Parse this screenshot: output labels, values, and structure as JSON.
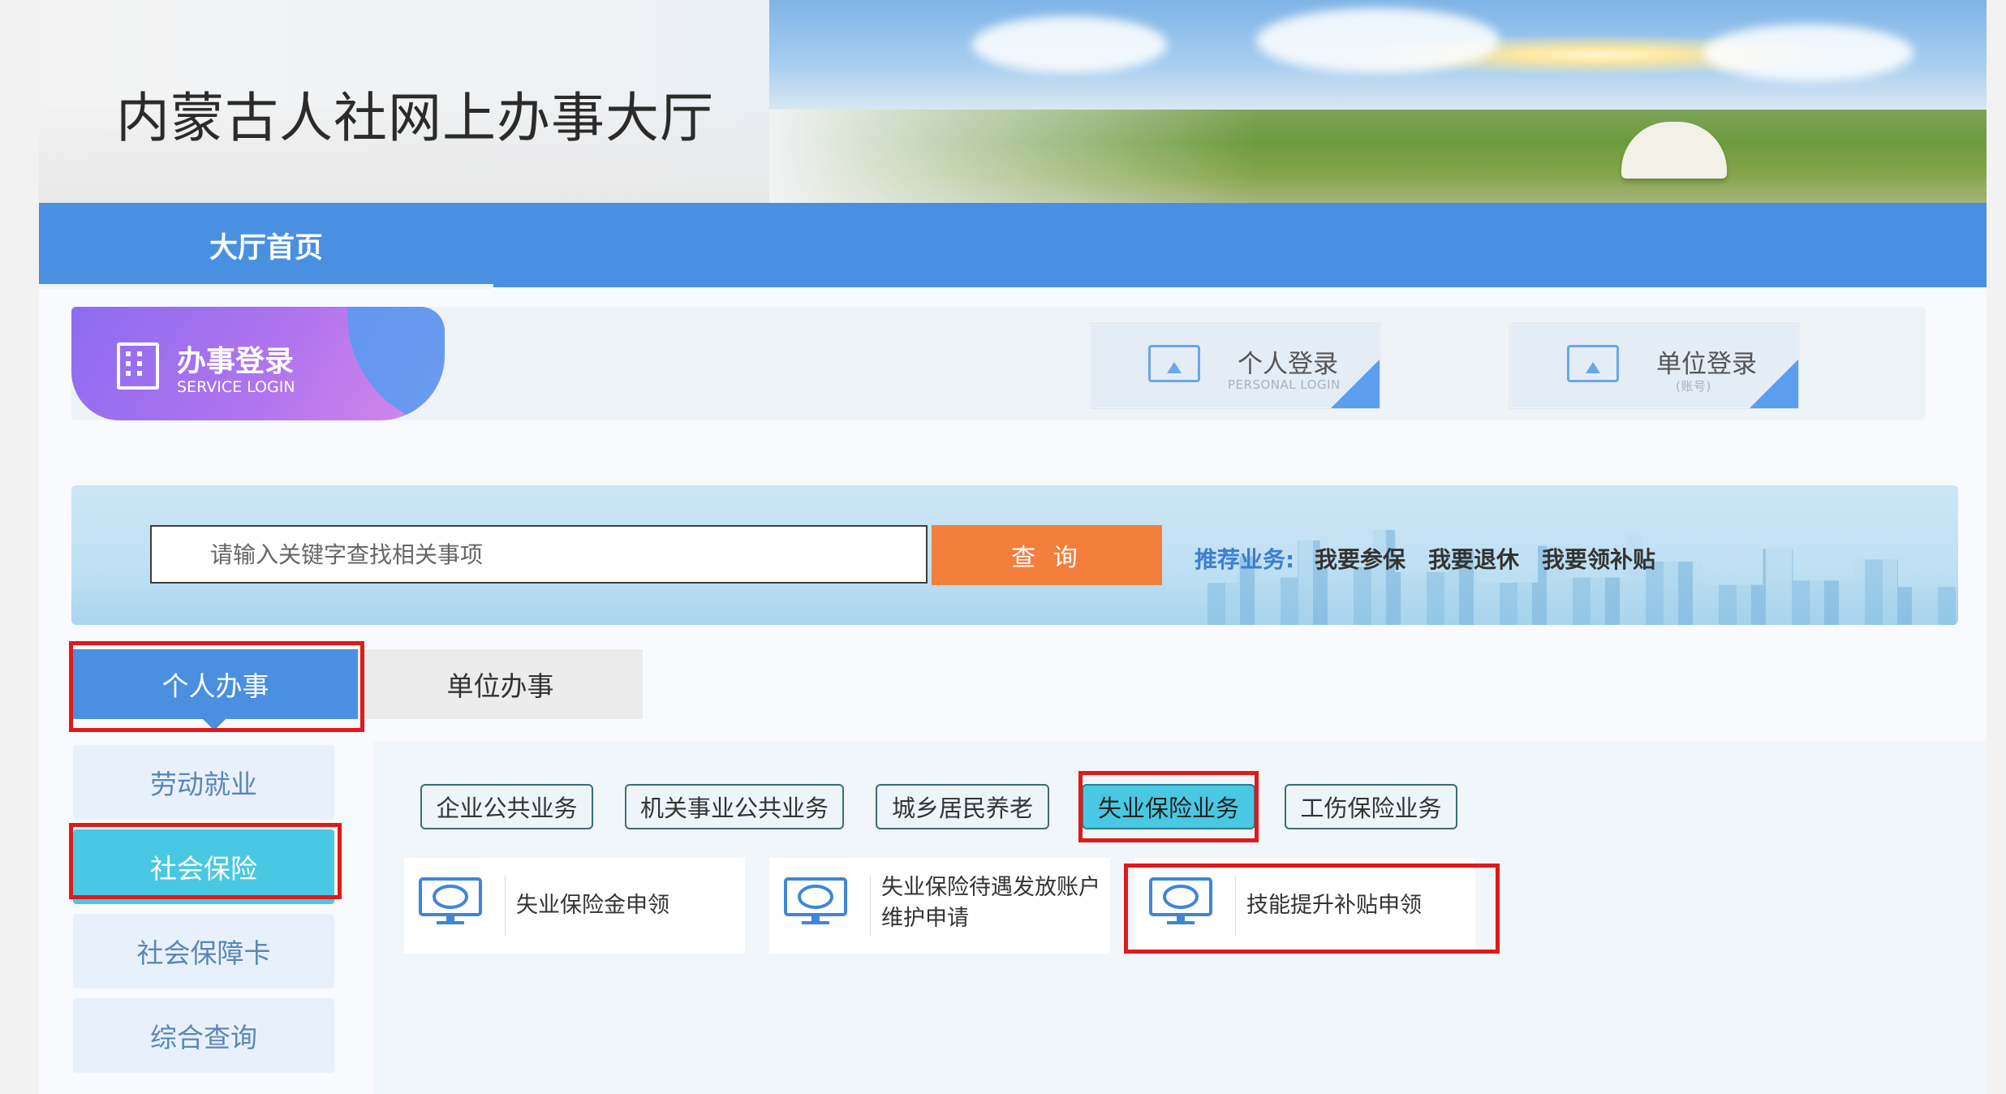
{
  "header": {
    "title": "内蒙古人社网上办事大厅"
  },
  "nav": {
    "home": "大厅首页"
  },
  "login": {
    "title": "办事登录",
    "subtitle": "SERVICE LOGIN",
    "personal": {
      "label": "个人登录",
      "sub": "PERSONAL LOGIN"
    },
    "unit": {
      "label": "单位登录",
      "sub": "(账号)"
    }
  },
  "search": {
    "placeholder": "请输入关键字查找相关事项",
    "button": "查 询",
    "recommend_label": "推荐业务:",
    "recommend": [
      "我要参保",
      "我要退休",
      "我要领补贴"
    ]
  },
  "tabs": {
    "personal": "个人办事",
    "unit": "单位办事"
  },
  "side_menu": [
    "劳动就业",
    "社会保险",
    "社会保障卡",
    "综合查询"
  ],
  "categories": [
    "企业公共业务",
    "机关事业公共业务",
    "城乡居民养老",
    "失业保险业务",
    "工伤保险业务"
  ],
  "services": [
    {
      "line1": "失业保险金申领",
      "line2": ""
    },
    {
      "line1": "失业保险待遇发放账户",
      "line2": "维护申请"
    },
    {
      "line1": "技能提升补贴申领",
      "line2": ""
    }
  ],
  "colors": {
    "nav": "#4a90e2",
    "accent": "#49c8e3",
    "search_button": "#f47e3c",
    "highlight": "#e0191b"
  }
}
